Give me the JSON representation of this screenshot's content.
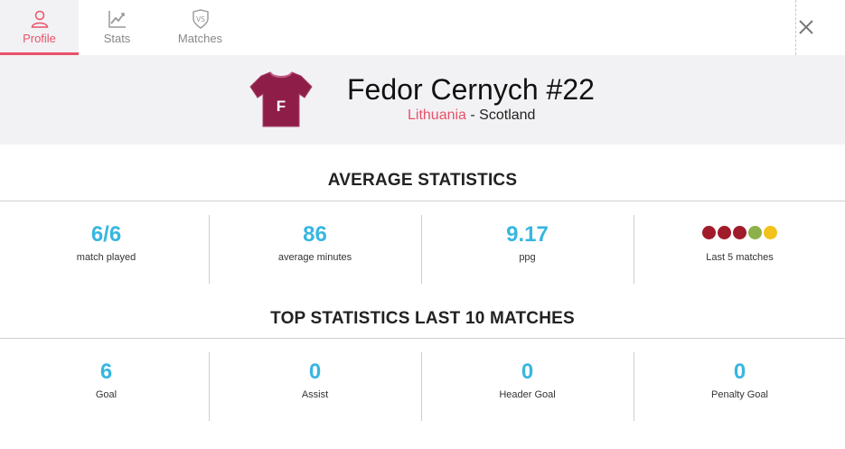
{
  "tabs": [
    {
      "label": "Profile",
      "icon": "user-icon",
      "active": true
    },
    {
      "label": "Stats",
      "icon": "chart-icon",
      "active": false
    },
    {
      "label": "Matches",
      "icon": "versus-shield-icon",
      "active": false
    }
  ],
  "close_icon": "close-icon",
  "player": {
    "name": "Fedor Cernych #22",
    "jersey_letter": "F",
    "country": "Lithuania",
    "separator": " - ",
    "team": "Scotland"
  },
  "average": {
    "title": "AVERAGE STATISTICS",
    "stats": [
      {
        "value": "6/6",
        "label": "match played"
      },
      {
        "value": "86",
        "label": "average minutes"
      },
      {
        "value": "9.17",
        "label": "ppg"
      }
    ],
    "last5": {
      "label": "Last 5 matches",
      "results": [
        "#a01c2a",
        "#a01c2a",
        "#a01c2a",
        "#8db04a",
        "#f2c21b"
      ]
    }
  },
  "top": {
    "title": "TOP STATISTICS LAST 10 MATCHES",
    "stats": [
      {
        "value": "6",
        "label": "Goal"
      },
      {
        "value": "0",
        "label": "Assist"
      },
      {
        "value": "0",
        "label": "Header Goal"
      },
      {
        "value": "0",
        "label": "Penalty Goal"
      }
    ]
  },
  "colors": {
    "accent": "#e8536a",
    "value": "#38b6e0",
    "jersey": "#8e1e48"
  }
}
